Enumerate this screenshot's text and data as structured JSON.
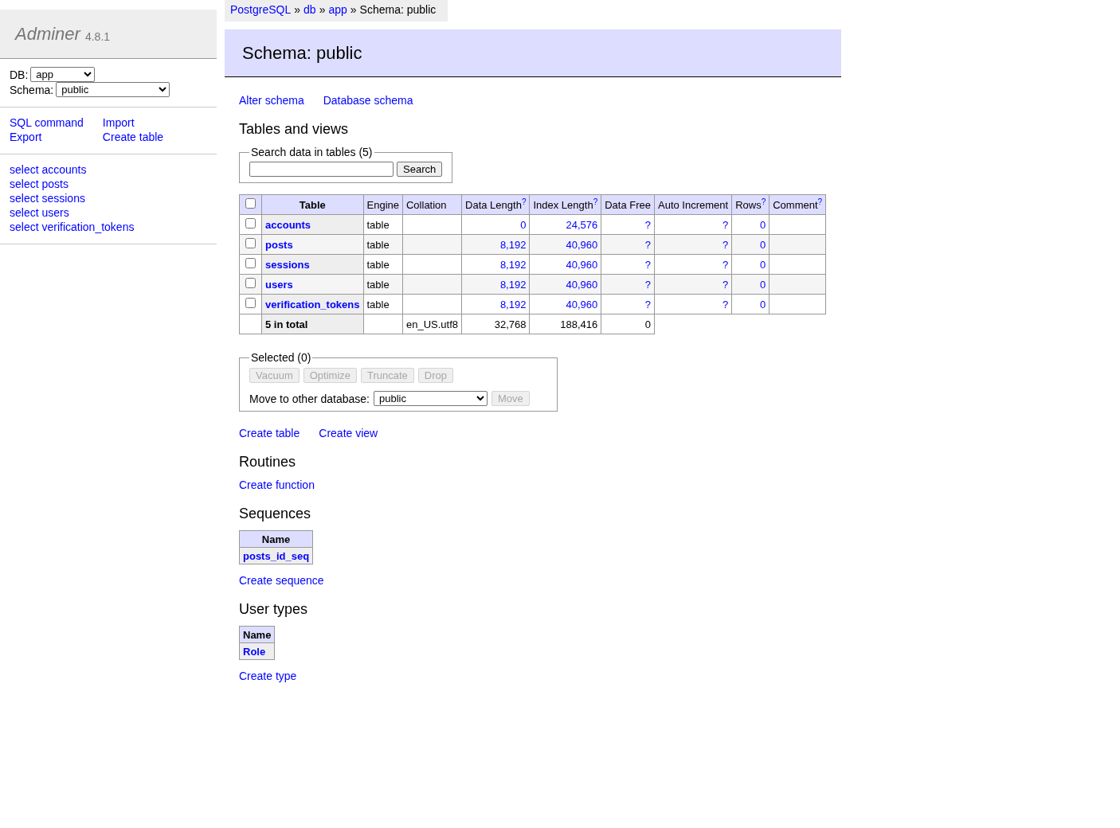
{
  "sidebar": {
    "logo": "Adminer",
    "version": "4.8.1",
    "db": {
      "label": "DB:",
      "value": "app"
    },
    "schema": {
      "label": "Schema:",
      "value": "public"
    },
    "links": [
      "SQL command",
      "Import",
      "Export",
      "Create table"
    ],
    "tables": [
      "select accounts",
      "select posts",
      "select sessions",
      "select users",
      "select verification_tokens"
    ]
  },
  "breadcrumb": {
    "crumbs": [
      "PostgreSQL",
      "db",
      "app"
    ],
    "separator": "»",
    "current": "Schema: public"
  },
  "title": "Schema: public",
  "actions": [
    "Alter schema",
    "Database schema"
  ],
  "tables_section": {
    "heading": "Tables and views",
    "search": {
      "legend": "Search data in tables (5)",
      "button": "Search"
    },
    "table": {
      "select_all_checked": false,
      "columns": [
        {
          "label": "Table"
        },
        {
          "label": "Engine"
        },
        {
          "label": "Collation"
        },
        {
          "label": "Data Length",
          "help": "?"
        },
        {
          "label": "Index Length",
          "help": "?"
        },
        {
          "label": "Data Free"
        },
        {
          "label": "Auto Increment"
        },
        {
          "label": "Rows",
          "help": "?"
        },
        {
          "label": "Comment",
          "help": "?"
        }
      ],
      "rows": [
        {
          "checked": false,
          "name": "accounts",
          "engine": "table",
          "data_length": "0",
          "index_length": "24,576",
          "data_free": "?",
          "auto_increment": "?",
          "rows": "0"
        },
        {
          "checked": false,
          "name": "posts",
          "engine": "table",
          "data_length": "8,192",
          "index_length": "40,960",
          "data_free": "?",
          "auto_increment": "?",
          "rows": "0"
        },
        {
          "checked": false,
          "name": "sessions",
          "engine": "table",
          "data_length": "8,192",
          "index_length": "40,960",
          "data_free": "?",
          "auto_increment": "?",
          "rows": "0"
        },
        {
          "checked": false,
          "name": "users",
          "engine": "table",
          "data_length": "8,192",
          "index_length": "40,960",
          "data_free": "?",
          "auto_increment": "?",
          "rows": "0"
        },
        {
          "checked": false,
          "name": "verification_tokens",
          "engine": "table",
          "data_length": "8,192",
          "index_length": "40,960",
          "data_free": "?",
          "auto_increment": "?",
          "rows": "0"
        }
      ],
      "total": {
        "label": "5 in total",
        "collation": "en_US.utf8",
        "data_length": "32,768",
        "index_length": "188,416",
        "data_free": "0"
      }
    },
    "selected": {
      "legend": "Selected (0)",
      "buttons": [
        {
          "label": "Vacuum",
          "disabled": true
        },
        {
          "label": "Optimize",
          "disabled": true
        },
        {
          "label": "Truncate",
          "disabled": true
        },
        {
          "label": "Drop",
          "disabled": true
        }
      ],
      "move_label": "Move to other database:",
      "move_value": "public",
      "move_button": {
        "label": "Move",
        "disabled": true
      }
    },
    "links": [
      "Create table",
      "Create view"
    ]
  },
  "routines": {
    "heading": "Routines",
    "links": [
      "Create function"
    ]
  },
  "sequences": {
    "heading": "Sequences",
    "column": "Name",
    "rows": [
      "posts_id_seq"
    ],
    "links": [
      "Create sequence"
    ]
  },
  "user_types": {
    "heading": "User types",
    "column": "Name",
    "rows": [
      "Role"
    ],
    "links": [
      "Create type"
    ]
  }
}
